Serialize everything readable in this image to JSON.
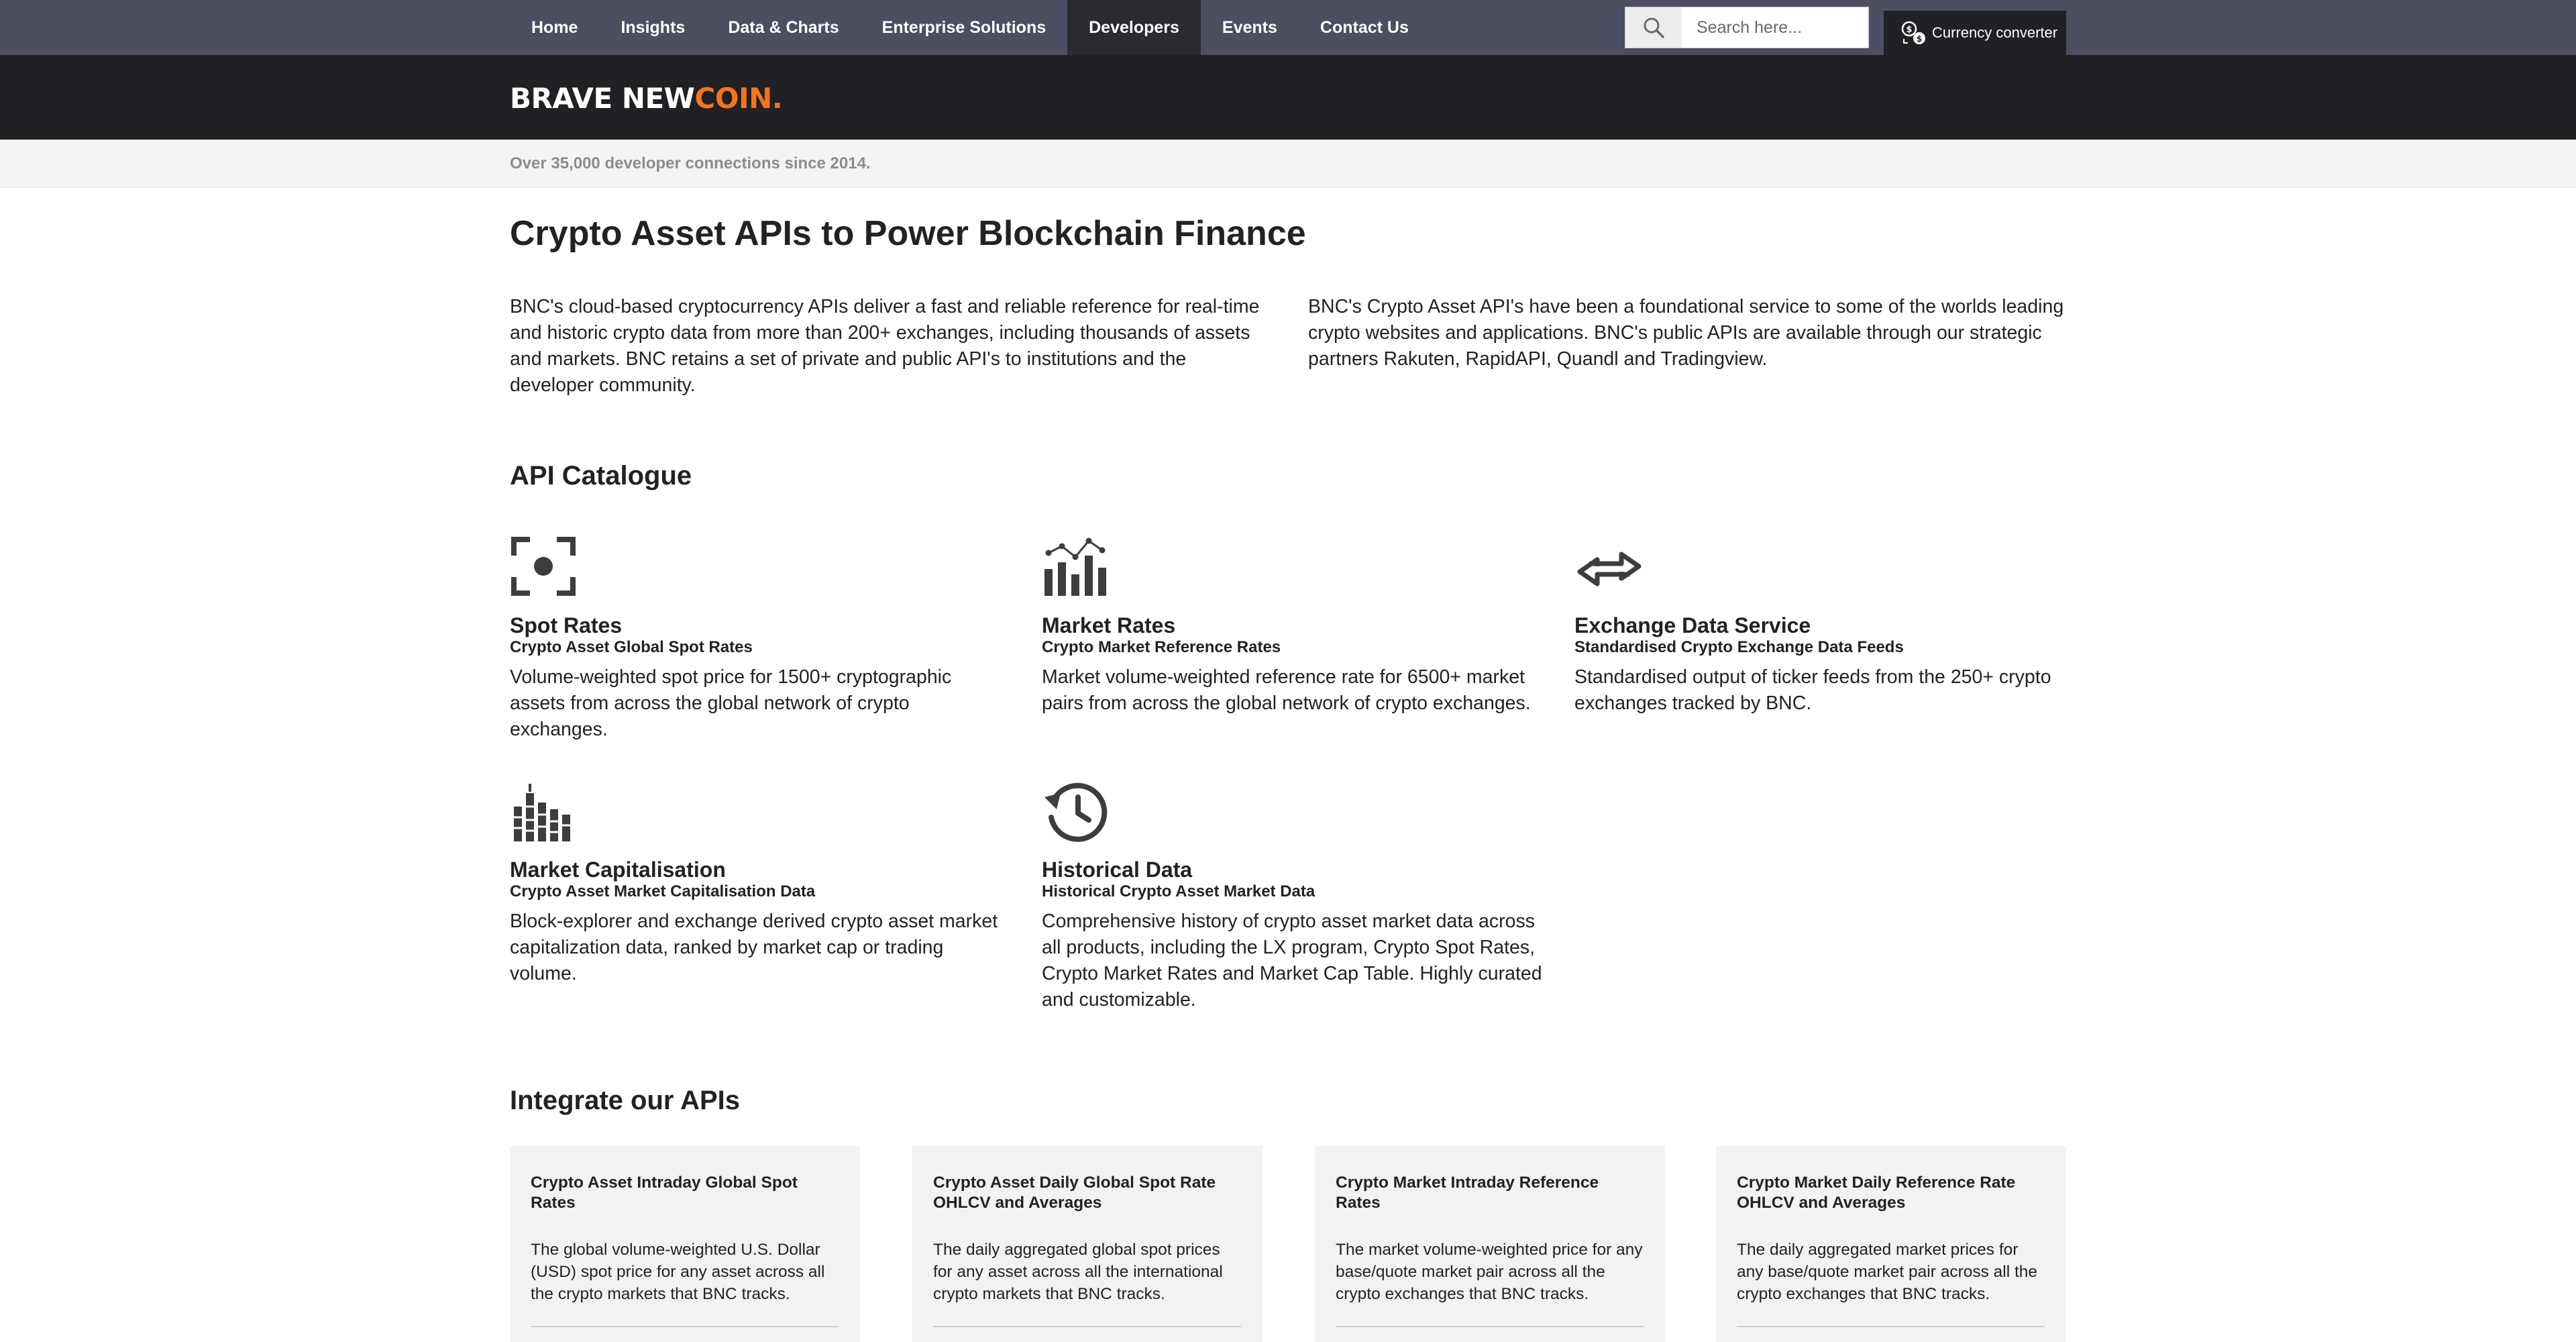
{
  "nav": {
    "items": [
      {
        "label": "Home",
        "active": false
      },
      {
        "label": "Insights",
        "active": false
      },
      {
        "label": "Data & Charts",
        "active": false
      },
      {
        "label": "Enterprise Solutions",
        "active": false
      },
      {
        "label": "Developers",
        "active": true
      },
      {
        "label": "Events",
        "active": false
      },
      {
        "label": "Contact Us",
        "active": false
      }
    ],
    "search": {
      "placeholder": "Search here...",
      "value": "",
      "icon": "search-icon"
    },
    "currency_converter": {
      "label": "Currency converter",
      "icon": "currency-converter-icon"
    }
  },
  "brand": {
    "word1": "BRAVE NEW",
    "word2": "COIN",
    "dot": ".",
    "accent_color": "#f7741d"
  },
  "subbar": {
    "text": "Over 35,000 developer connections since 2014."
  },
  "main": {
    "title": "Crypto Asset APIs to Power Blockchain Finance",
    "intro_left": "BNC's cloud-based cryptocurrency APIs deliver a fast and reliable reference for real-time and historic crypto data from more than 200+ exchanges, including thousands of assets and markets. BNC retains a set of private and public API's to institutions and the developer community.",
    "intro_right": "BNC's Crypto Asset API's have been a foundational service to some of the worlds leading crypto websites and applications. BNC's public APIs are available through our strategic partners Rakuten, RapidAPI, Quandl and Tradingview."
  },
  "catalogue": {
    "title": "API Catalogue",
    "items": [
      {
        "icon": "target-icon",
        "name": "Spot Rates",
        "subtitle": "Crypto Asset Global Spot Rates",
        "description": "Volume-weighted spot price for 1500+ cryptographic assets from across the global network of crypto exchanges."
      },
      {
        "icon": "bar-chart-icon",
        "name": "Market Rates",
        "subtitle": "Crypto Market Reference Rates",
        "description": "Market volume-weighted reference rate for 6500+ market pairs from across the global network of crypto exchanges."
      },
      {
        "icon": "exchange-arrows-icon",
        "name": "Exchange Data Service",
        "subtitle": "Standardised Crypto Exchange Data Feeds",
        "description": "Standardised output of ticker feeds from the 250+ crypto exchanges tracked by BNC."
      },
      {
        "icon": "market-cap-icon",
        "name": "Market Capitalisation",
        "subtitle": "Crypto Asset Market Capitalisation Data",
        "description": "Block-explorer and exchange derived crypto asset market capitalization data, ranked by market cap or trading volume."
      },
      {
        "icon": "history-clock-icon",
        "name": "Historical Data",
        "subtitle": "Historical Crypto Asset Market Data",
        "description": "Comprehensive history of crypto asset market data across all products, including the LX program, Crypto Spot Rates, Crypto Market Rates and Market Cap Table. Highly curated and customizable."
      }
    ]
  },
  "integrate": {
    "title": "Integrate our APIs",
    "cards": [
      {
        "title": "Crypto Asset Intraday Global Spot Rates",
        "description": "The global volume-weighted U.S. Dollar (USD) spot price for any asset across all the crypto markets that BNC tracks."
      },
      {
        "title": "Crypto Asset Daily Global Spot Rate OHLCV and Averages",
        "description": "The daily aggregated global spot prices for any asset across all the international crypto markets that BNC tracks."
      },
      {
        "title": "Crypto Market Intraday Reference Rates",
        "description": "The market volume-weighted price for any base/quote market pair across all the crypto exchanges that BNC tracks."
      },
      {
        "title": "Crypto Market Daily Reference Rate OHLCV and Averages",
        "description": "The daily aggregated market prices for any base/quote market pair across all the crypto exchanges that BNC tracks."
      }
    ]
  }
}
